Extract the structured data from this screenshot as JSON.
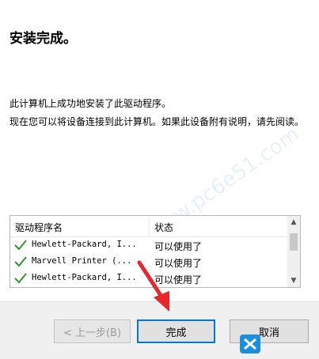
{
  "header": {
    "title": "安装完成。"
  },
  "body": {
    "line1": "此计算机上成功地安装了此驱动程序。",
    "line2": "现在您可以将设备连接到此计算机。如果此设备附有说明，请先阅读。"
  },
  "table": {
    "columns": [
      "驱动程序名",
      "状态"
    ],
    "rows": [
      {
        "name": "Hewlett-Packard, I...",
        "status": "可以使用了",
        "icon": "check-icon"
      },
      {
        "name": "Marvell Printer  (...",
        "status": "可以使用了",
        "icon": "check-icon"
      },
      {
        "name": "Hewlett-Packard, I...",
        "status": "可以使用了",
        "icon": "check-icon"
      }
    ]
  },
  "buttons": {
    "back": "< 上一步(B)",
    "finish": "完成",
    "cancel": "取消"
  },
  "watermark": "软件 www.pc6e51.com",
  "colors": {
    "check": "#2e9b2e",
    "focus_border": "#0078d7",
    "arrow": "#e8262c"
  }
}
